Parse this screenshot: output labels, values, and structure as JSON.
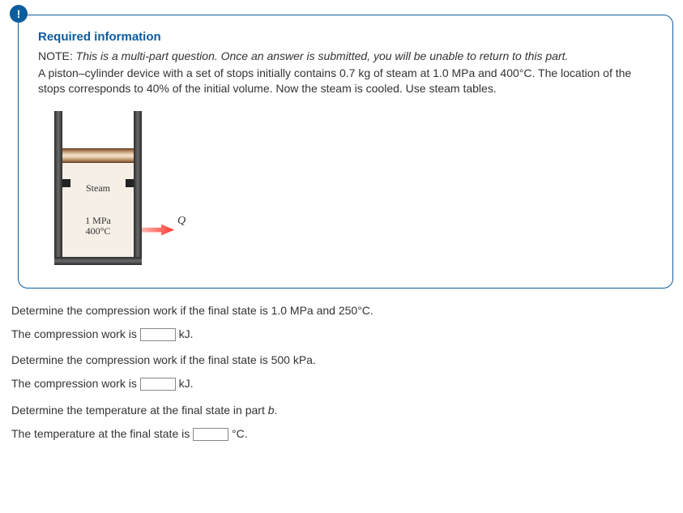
{
  "alert": "!",
  "info": {
    "title": "Required information",
    "note_prefix": "NOTE:",
    "note_body": "This is a multi-part question. Once an answer is submitted, you will be unable to return to this part.",
    "problem": "A piston–cylinder device with a set of stops initially contains 0.7 kg of steam at 1.0 MPa and 400°C. The location of the stops corresponds to 40% of the initial volume. Now the steam is cooled. Use steam tables."
  },
  "figure": {
    "steam_label": "Steam",
    "pressure": "1 MPa",
    "temperature": "400°C",
    "q": "Q"
  },
  "q1": {
    "prompt": "Determine the compression work if the final state is 1.0 MPa and 250°C.",
    "answer_prefix": "The compression work is ",
    "unit": " kJ."
  },
  "q2": {
    "prompt": "Determine the compression work if the final state is 500 kPa.",
    "answer_prefix": "The compression work is ",
    "unit": " kJ."
  },
  "q3": {
    "prompt_a": "Determine the temperature at the final state in part ",
    "prompt_b": "b",
    "prompt_c": ".",
    "answer_prefix": "The temperature at the final state is ",
    "unit": " °C."
  }
}
